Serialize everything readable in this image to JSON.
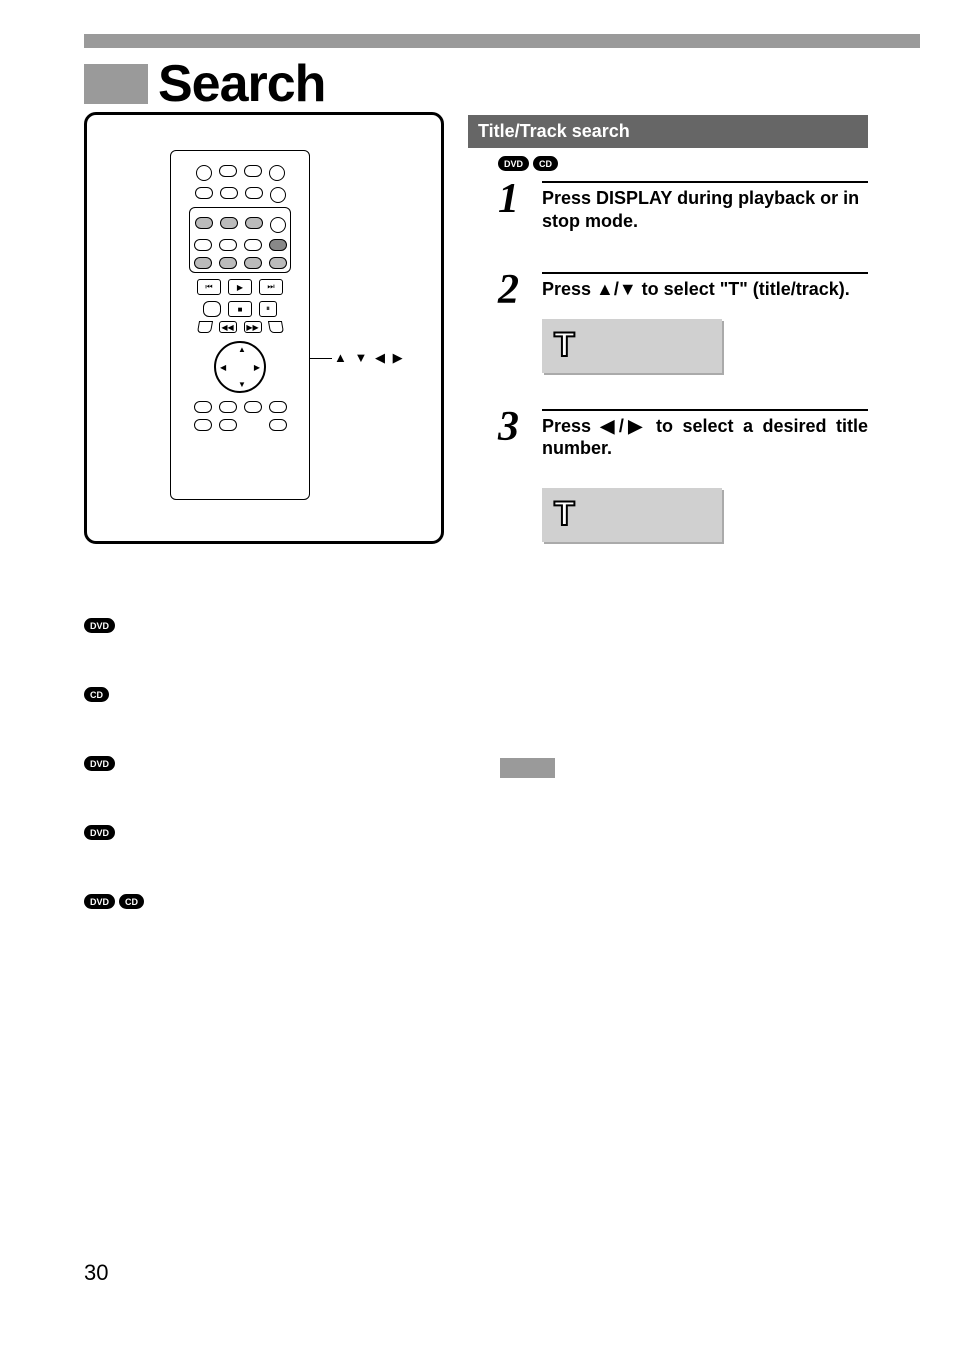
{
  "page": {
    "title": "Search",
    "number": "30"
  },
  "remote": {
    "arrows_label": "▲ ▼ ◀ ▶"
  },
  "section": {
    "header": "Title/Track search",
    "discs": [
      "DVD",
      "CD"
    ],
    "steps": [
      {
        "num": "1",
        "text": "Press DISPLAY during playback or in stop mode."
      },
      {
        "num": "2",
        "text": "Press ▲/▼ to select \"T\" (title/track)."
      },
      {
        "num": "3",
        "text": "Press ◀/▶ to select a desired title number."
      }
    ],
    "display_glyph": "T"
  },
  "notes": {
    "items": [
      {
        "discs": [
          "DVD"
        ]
      },
      {
        "discs": [
          "CD"
        ]
      },
      {
        "discs": [
          "DVD"
        ]
      },
      {
        "discs": [
          "DVD"
        ]
      },
      {
        "discs": [
          "DVD",
          "CD"
        ]
      }
    ]
  }
}
